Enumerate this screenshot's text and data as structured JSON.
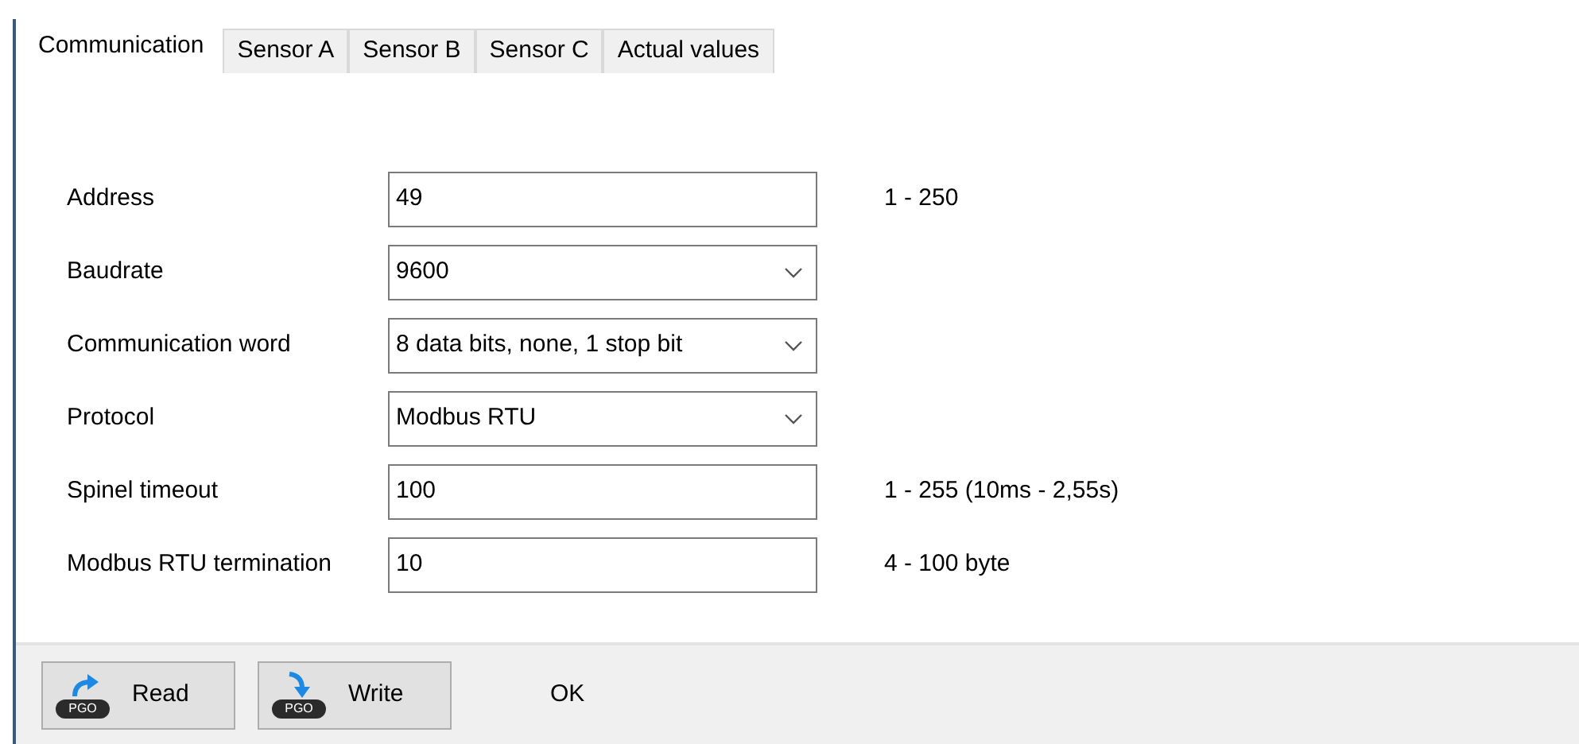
{
  "tabs": [
    {
      "label": "Communication",
      "selected": true
    },
    {
      "label": "Sensor A",
      "selected": false
    },
    {
      "label": "Sensor B",
      "selected": false
    },
    {
      "label": "Sensor C",
      "selected": false
    },
    {
      "label": "Actual values",
      "selected": false
    }
  ],
  "fields": [
    {
      "label": "Address",
      "kind": "text",
      "value": "49",
      "hint": "1 - 250"
    },
    {
      "label": "Baudrate",
      "kind": "dropdown",
      "value": "9600"
    },
    {
      "label": "Communication word",
      "kind": "dropdown",
      "value": "8 data bits, none, 1 stop bit"
    },
    {
      "label": "Protocol",
      "kind": "dropdown",
      "value": "Modbus RTU"
    },
    {
      "label": "Spinel timeout",
      "kind": "text",
      "value": "100",
      "hint": "1 - 255 (10ms - 2,55s)"
    },
    {
      "label": "Modbus RTU termination",
      "kind": "text",
      "value": "10",
      "hint": "4 - 100 byte"
    }
  ],
  "buttons": [
    {
      "label": "Read",
      "kind": "read",
      "badge": "PGO"
    },
    {
      "label": "Write",
      "kind": "write",
      "badge": "PGO"
    }
  ],
  "status": "OK"
}
